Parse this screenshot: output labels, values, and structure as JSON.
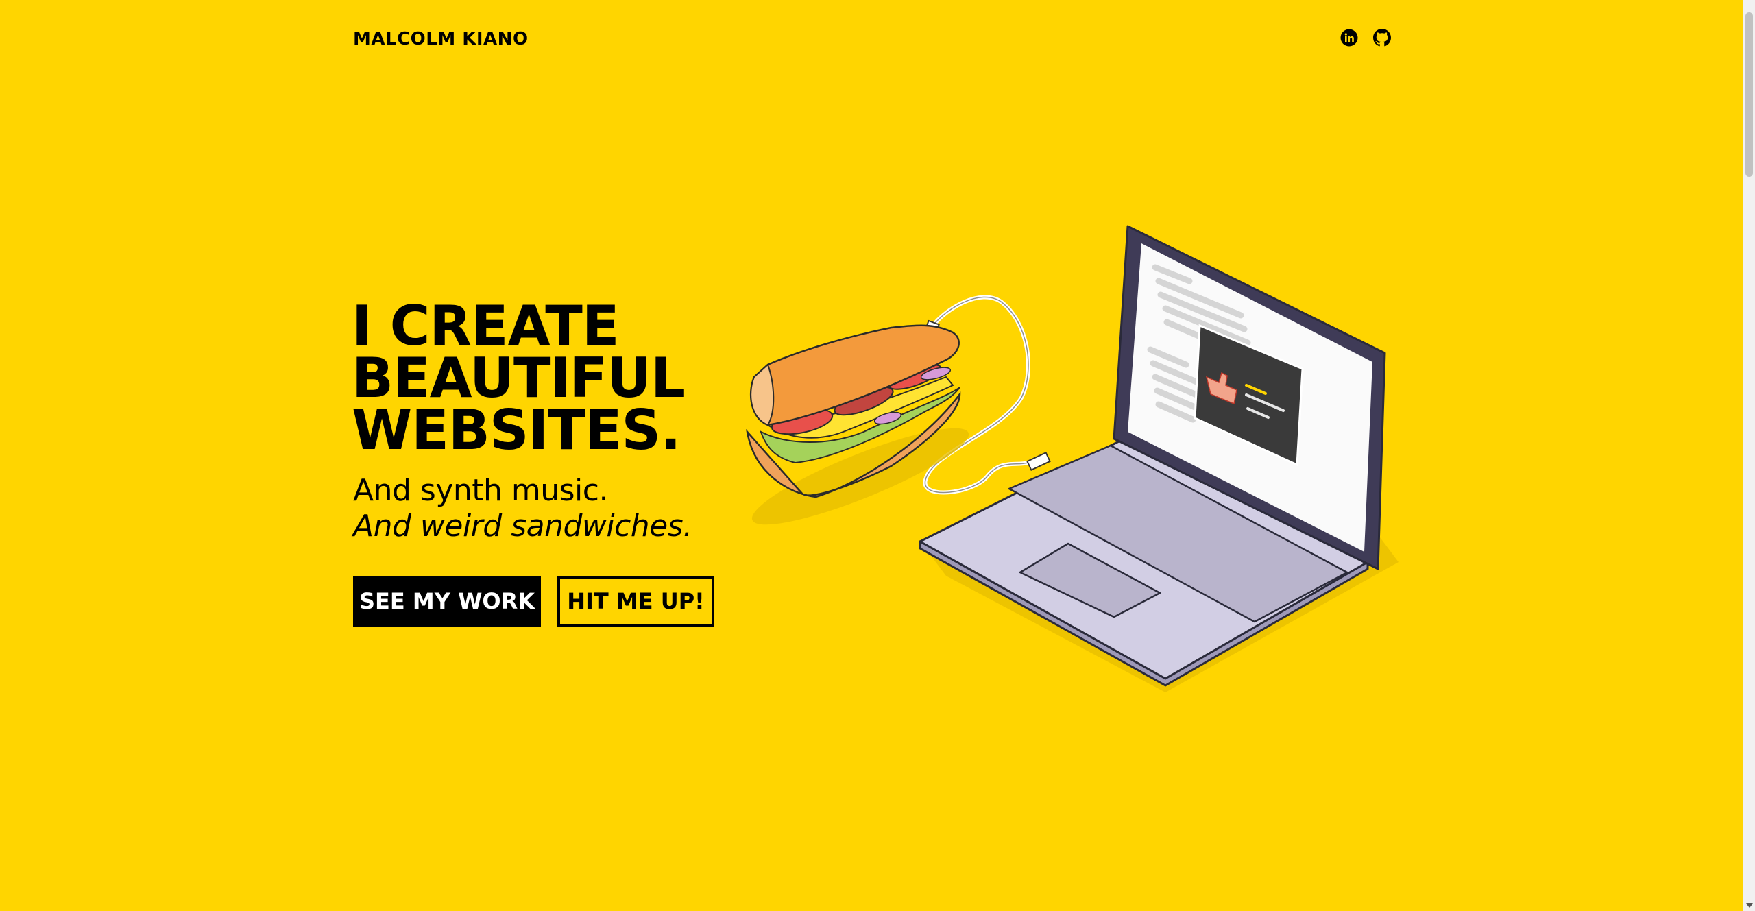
{
  "header": {
    "brand": "MALCOLM KIANO",
    "social": [
      {
        "icon": "linkedin-icon"
      },
      {
        "icon": "github-icon"
      }
    ]
  },
  "hero": {
    "title_lines": [
      "I CREATE",
      "BEAUTIFUL",
      "WEBSITES."
    ],
    "subtitle_line1": "And synth music.",
    "subtitle_line2": "And weird sandwiches.",
    "primary_button": "SEE MY WORK",
    "secondary_button": "HIT ME UP!"
  },
  "colors": {
    "background": "#FFD500",
    "text": "#000000",
    "button_primary_bg": "#000000",
    "button_primary_text": "#FFFFFF"
  }
}
